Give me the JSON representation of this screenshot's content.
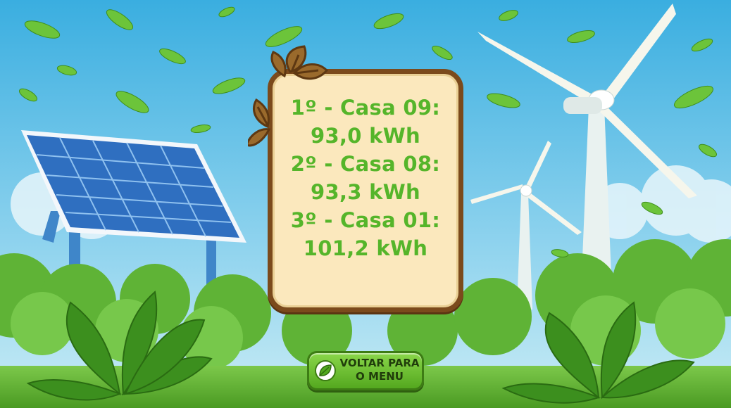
{
  "ranking": {
    "lines": [
      "1º - Casa 09:",
      "93,0 kWh",
      "2º - Casa 08:",
      "93,3 kWh",
      "3º - Casa 01:",
      "101,2 kWh"
    ]
  },
  "menu_button": {
    "label_line1": "VOLTAR PARA",
    "label_line2": "O MENU"
  },
  "icons": {
    "button_icon": "leaf-icon",
    "board_decoration": "leaves-icon"
  },
  "colors": {
    "rank_text": "#55b52a",
    "board_fill": "#fbe8bd",
    "board_border": "#7b4a1c",
    "button_fill": "#6cbf32",
    "sky": "#4fb6e2"
  }
}
